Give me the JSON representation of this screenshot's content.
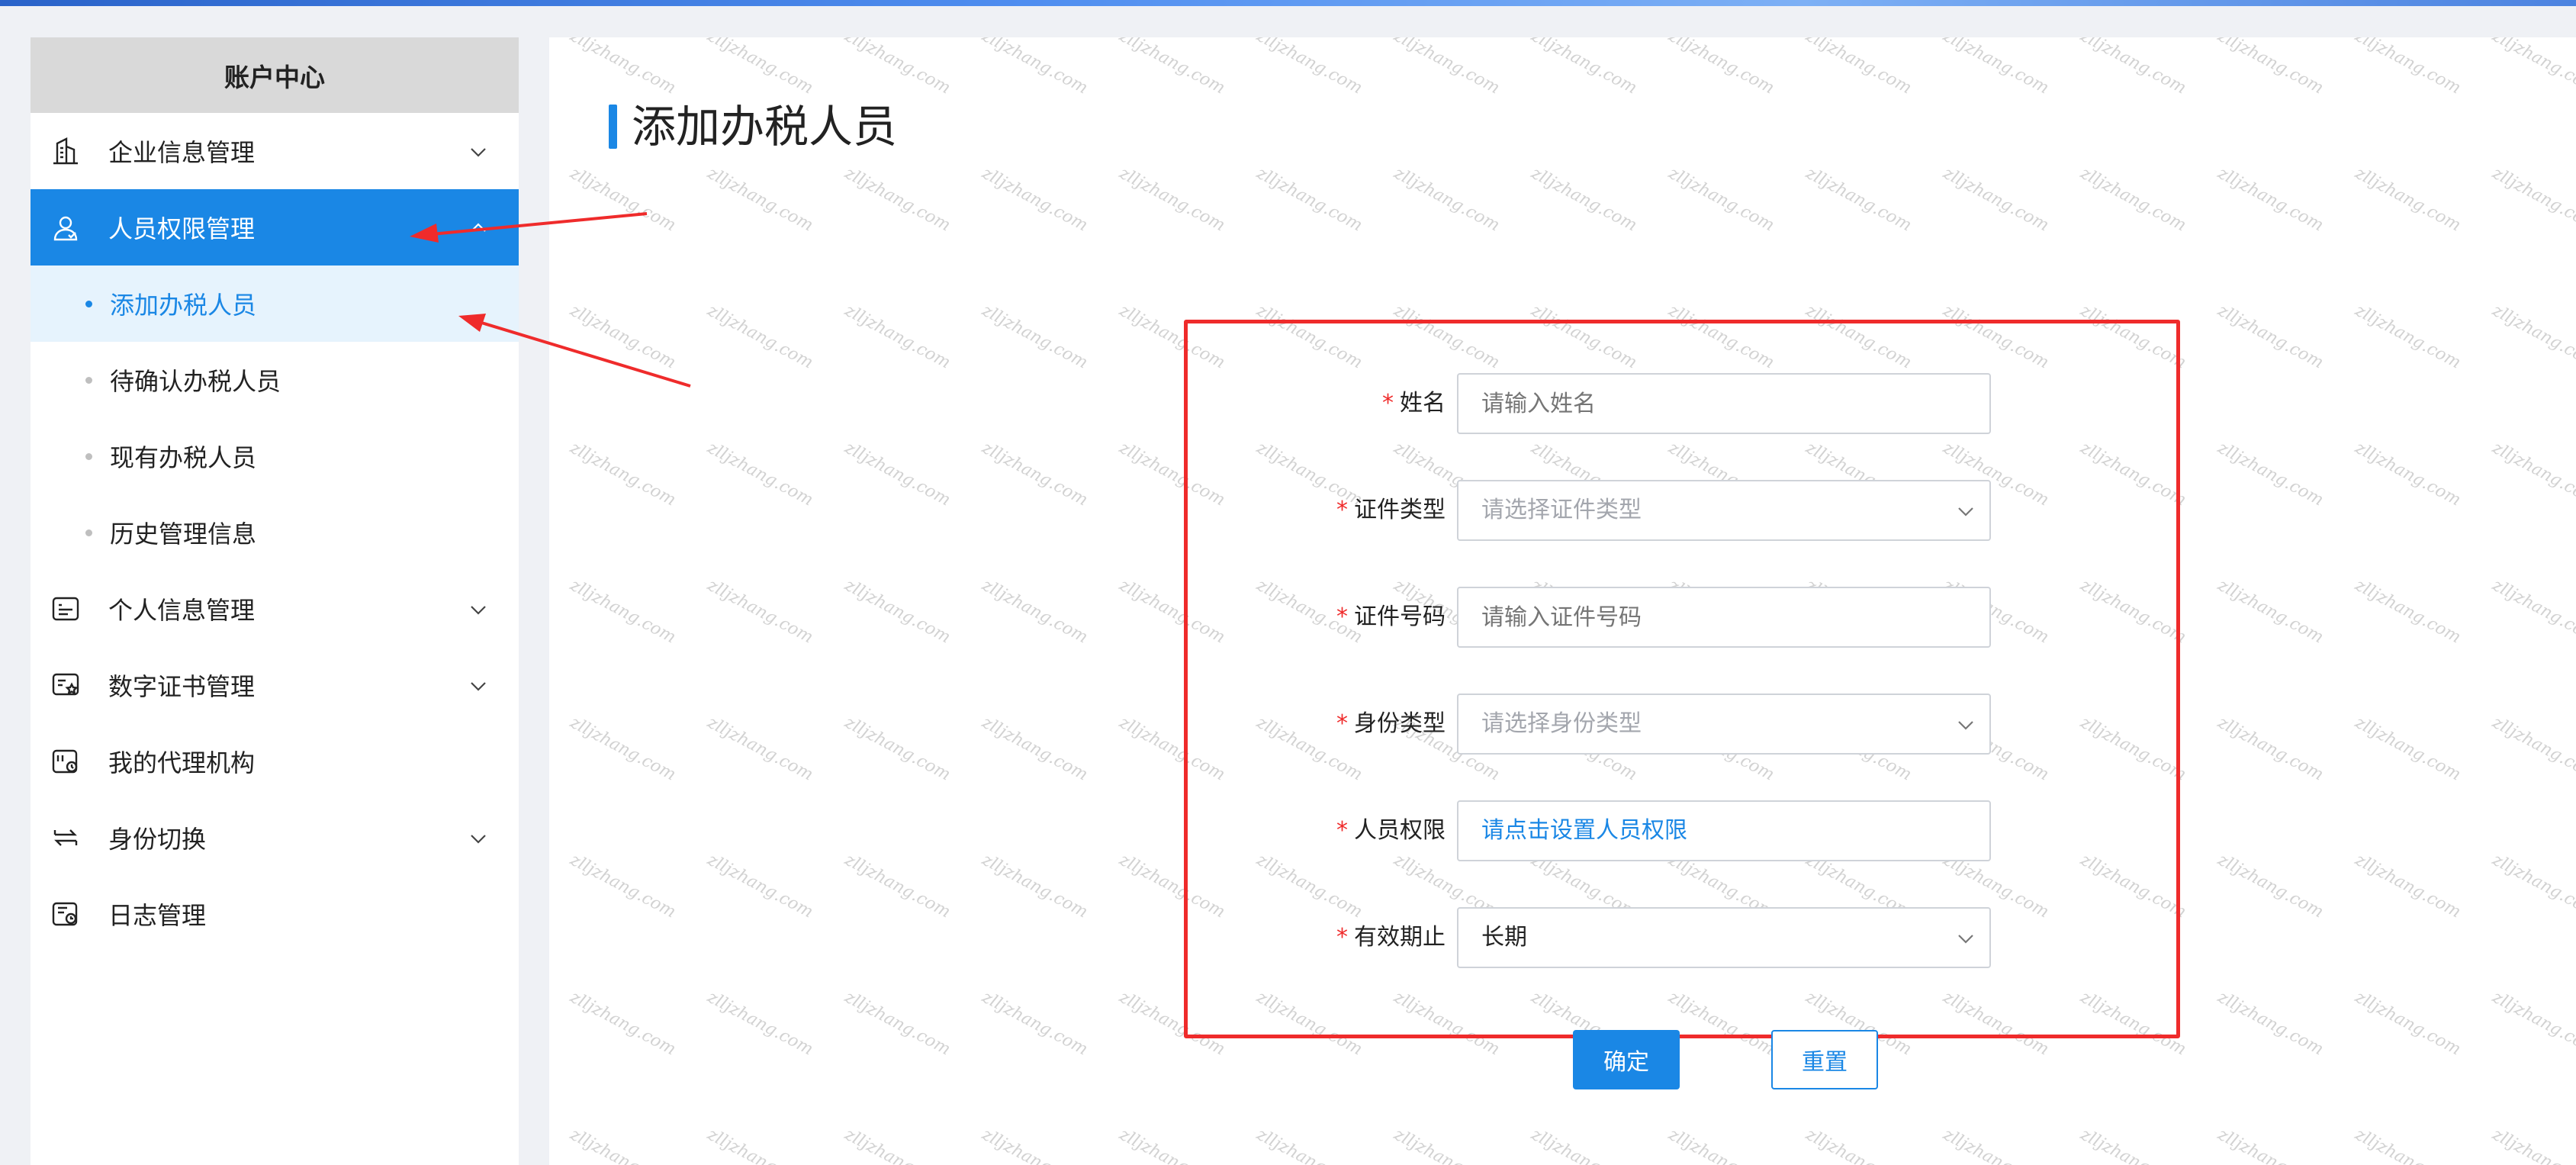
{
  "sidebar": {
    "title": "账户中心",
    "items": [
      {
        "label": "企业信息管理",
        "icon": "building-icon",
        "has_chevron": true
      },
      {
        "label": "人员权限管理",
        "icon": "user-group-icon",
        "has_chevron": true,
        "active": true,
        "sub_items": [
          {
            "label": "添加办税人员",
            "selected": true
          },
          {
            "label": "待确认办税人员"
          },
          {
            "label": "现有办税人员"
          },
          {
            "label": "历史管理信息"
          }
        ]
      },
      {
        "label": "个人信息管理",
        "icon": "id-card-icon",
        "has_chevron": true
      },
      {
        "label": "数字证书管理",
        "icon": "certificate-icon",
        "has_chevron": true
      },
      {
        "label": "我的代理机构",
        "icon": "agency-icon",
        "has_chevron": false
      },
      {
        "label": "身份切换",
        "icon": "switch-icon",
        "has_chevron": true
      },
      {
        "label": "日志管理",
        "icon": "log-icon",
        "has_chevron": false
      }
    ]
  },
  "main": {
    "title": "添加办税人员",
    "form": {
      "required_mark": "*",
      "name": {
        "label": "姓名",
        "placeholder": "请输入姓名"
      },
      "id_type": {
        "label": "证件类型",
        "placeholder": "请选择证件类型"
      },
      "id_number": {
        "label": "证件号码",
        "placeholder": "请输入证件号码"
      },
      "identity_type": {
        "label": "身份类型",
        "placeholder": "请选择身份类型"
      },
      "permission": {
        "label": "人员权限",
        "link_text": "请点击设置人员权限"
      },
      "validity": {
        "label": "有效期止",
        "value": "长期"
      }
    },
    "buttons": {
      "confirm": "确定",
      "reset": "重置"
    }
  },
  "watermark_text": "zlljzhang.com",
  "colors": {
    "primary": "#1a87e5",
    "annotation_red": "#ef2b2b",
    "sidebar_header": "#d9d9d9"
  }
}
